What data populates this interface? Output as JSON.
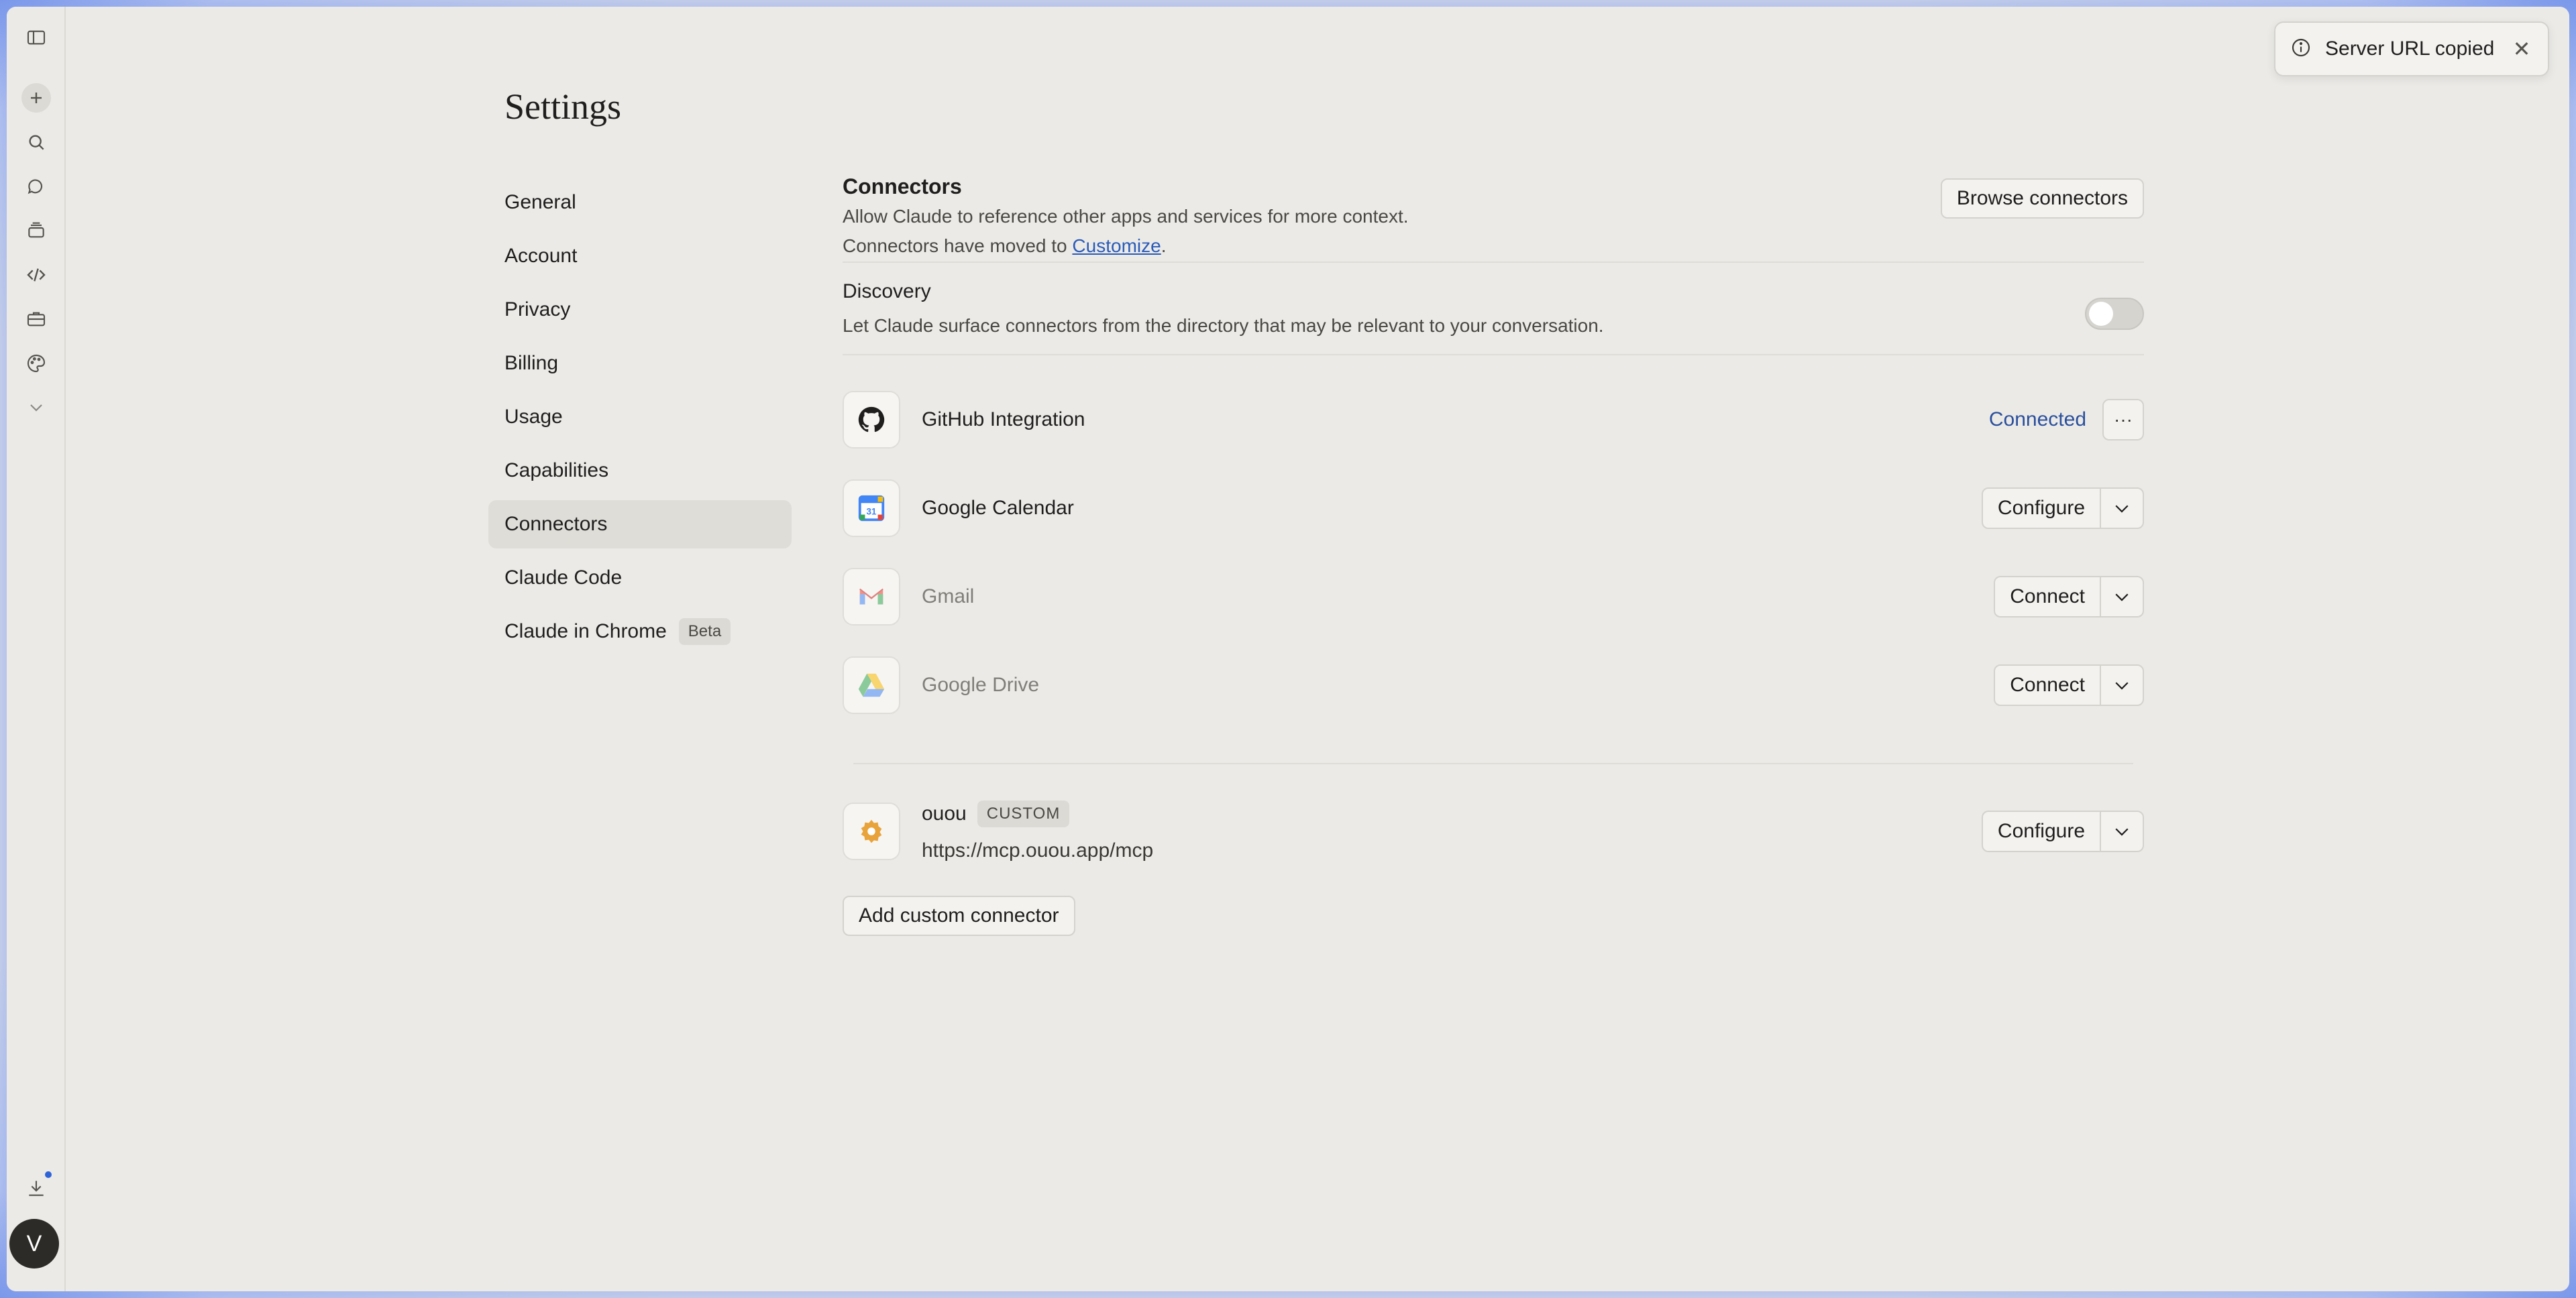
{
  "page": {
    "title": "Settings"
  },
  "nav": {
    "items": [
      {
        "label": "General"
      },
      {
        "label": "Account"
      },
      {
        "label": "Privacy"
      },
      {
        "label": "Billing"
      },
      {
        "label": "Usage"
      },
      {
        "label": "Capabilities"
      },
      {
        "label": "Connectors",
        "active": true
      },
      {
        "label": "Claude Code"
      },
      {
        "label": "Claude in Chrome",
        "badge": "Beta"
      }
    ]
  },
  "connectors": {
    "title": "Connectors",
    "description": "Allow Claude to reference other apps and services for more context.",
    "moved_prefix": "Connectors have moved to ",
    "moved_link": "Customize",
    "moved_suffix": ".",
    "browse_label": "Browse connectors",
    "discovery": {
      "title": "Discovery",
      "description": "Let Claude surface connectors from the directory that may be relevant to your conversation.",
      "enabled": false
    },
    "list": [
      {
        "name": "GitHub Integration",
        "icon": "github-icon",
        "status": "Connected",
        "more": "···"
      },
      {
        "name": "Google Calendar",
        "icon": "google-calendar-icon",
        "action": "Configure"
      },
      {
        "name": "Gmail",
        "icon": "gmail-icon",
        "action": "Connect"
      },
      {
        "name": "Google Drive",
        "icon": "google-drive-icon",
        "action": "Connect"
      }
    ],
    "custom": {
      "name": "ouou",
      "tag": "CUSTOM",
      "url": "https://mcp.ouou.app/mcp",
      "action": "Configure",
      "icon": "custom-connector-icon"
    },
    "add_custom_label": "Add custom connector"
  },
  "rail": {
    "icons": [
      "sidebar-toggle-icon",
      "new-chat-icon",
      "search-icon",
      "chats-icon",
      "projects-icon",
      "code-icon",
      "briefcase-icon",
      "palette-icon",
      "chevron-down-icon",
      "download-icon"
    ],
    "avatar_initial": "V"
  },
  "toast": {
    "text": "Server URL copied",
    "icon": "info-icon"
  },
  "colors": {
    "background": "#ebeae7",
    "link": "#2a5bb8",
    "connected": "#2a4f9c",
    "notification_dot": "#2e63d8"
  }
}
